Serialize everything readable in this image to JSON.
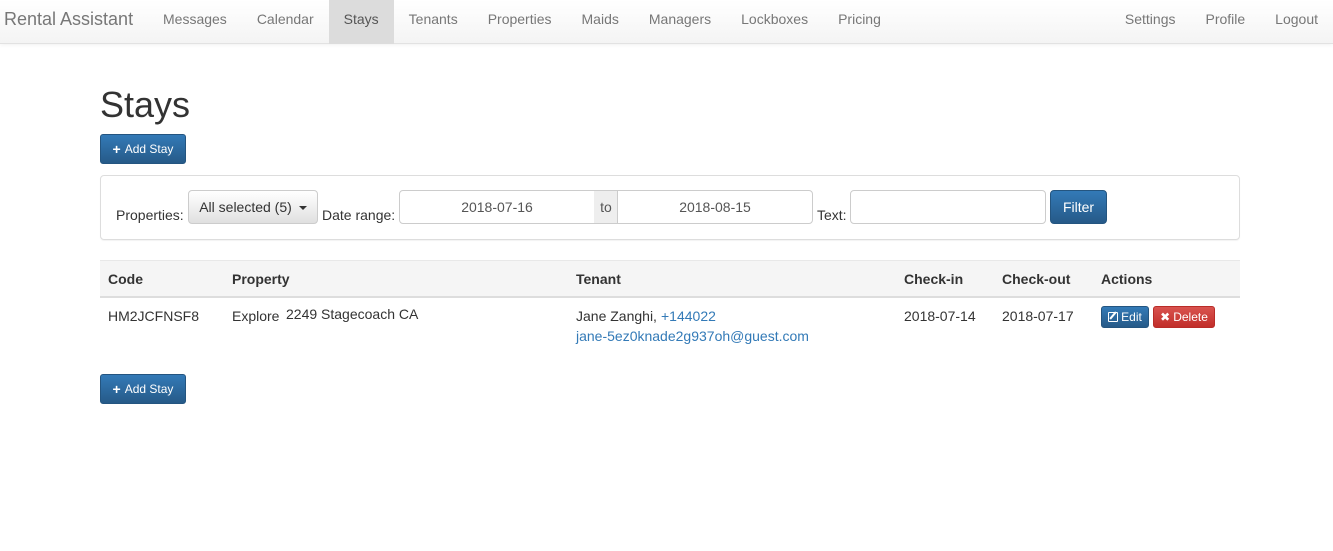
{
  "navbar": {
    "brand": "Rental Assistant",
    "left_items": [
      "Messages",
      "Calendar",
      "Stays",
      "Tenants",
      "Properties",
      "Maids",
      "Managers",
      "Lockboxes",
      "Pricing"
    ],
    "active_item": "Stays",
    "right_items": [
      "Settings",
      "Profile",
      "Logout"
    ]
  },
  "page": {
    "title": "Stays",
    "add_button": "Add Stay"
  },
  "filters": {
    "properties_label": "Properties:",
    "properties_value": "All selected (5)",
    "date_range_label": "Date range:",
    "date_from": "2018-07-16",
    "date_separator": "to",
    "date_to": "2018-08-15",
    "text_label": "Text:",
    "text_value": "",
    "filter_button": "Filter"
  },
  "table": {
    "headers": [
      "Code",
      "Property",
      "Tenant",
      "Check-in",
      "Check-out",
      "Actions"
    ],
    "rows": [
      {
        "code": "HM2JCFNSF8",
        "property_prefix": "Explore",
        "property_name": "2249 Stagecoach CA",
        "tenant_name": "Jane Zanghi,",
        "tenant_phone": "+144022",
        "tenant_email": "jane-5ez0knade2g937oh@guest.com",
        "check_in": "2018-07-14",
        "check_out": "2018-07-17",
        "edit_label": "Edit",
        "delete_label": "Delete"
      }
    ]
  },
  "colors": {
    "primary": "#337ab7",
    "danger": "#d9534f",
    "nav_active_bg": "#dcdcdc"
  }
}
